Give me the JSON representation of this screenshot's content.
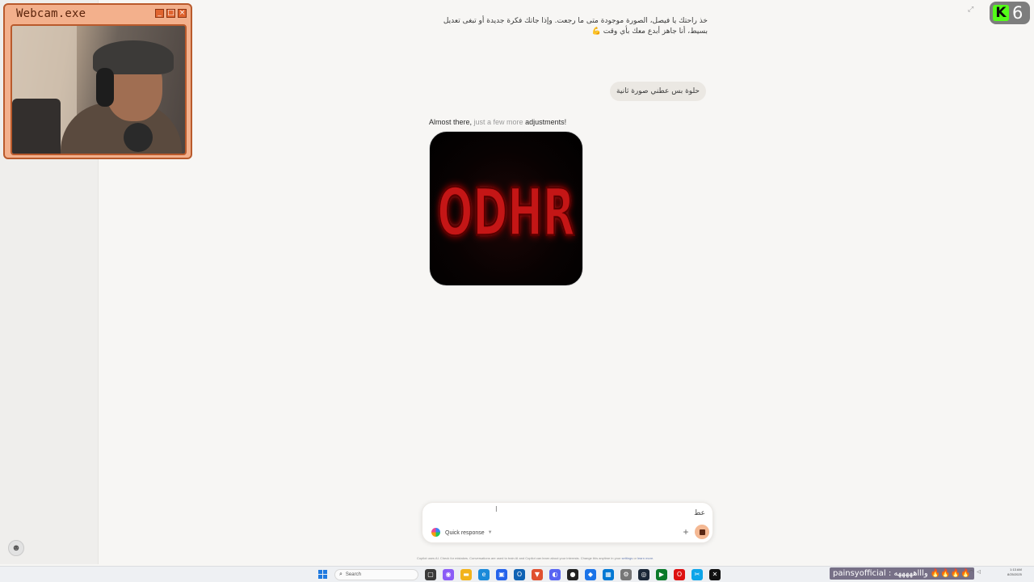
{
  "webcam": {
    "title": "Webcam.exe",
    "controls": [
      "_",
      "□",
      "×"
    ]
  },
  "kick": {
    "viewer_count": "6",
    "logo_text": "K",
    "accent": "#53fc18"
  },
  "chat": {
    "bot_message": "خذ راحتك يا فيصل، الصورة موجودة متى ما رجعت. وإذا جاتك فكرة جديدة أو تبغى تعديل بسيط، أنا جاهز أبدع معك بأي وقت 💪",
    "user_message": "حلوة بس عطني صورة ثانية",
    "status": {
      "part1": "Almost there, ",
      "part2": "just a few more",
      "part3": " adjustments!"
    },
    "image_text": "ODHR"
  },
  "composer": {
    "input_value": "عط",
    "mode_label": "Quick response",
    "disclaimer": "Copilot uses AI. Check for mistakes. Conversations are used to train AI and Copilot can learn about your interests. Change this anytime in your",
    "disclaimer_link1": "settings",
    "disclaimer_or": " or ",
    "disclaimer_link2": "learn more."
  },
  "taskbar": {
    "search_placeholder": "Search",
    "stream_chat": "painsyofficial : واااهههههه 🔥🔥🔥🔥",
    "time": "1:13 AM",
    "date": "8/25/2025"
  }
}
